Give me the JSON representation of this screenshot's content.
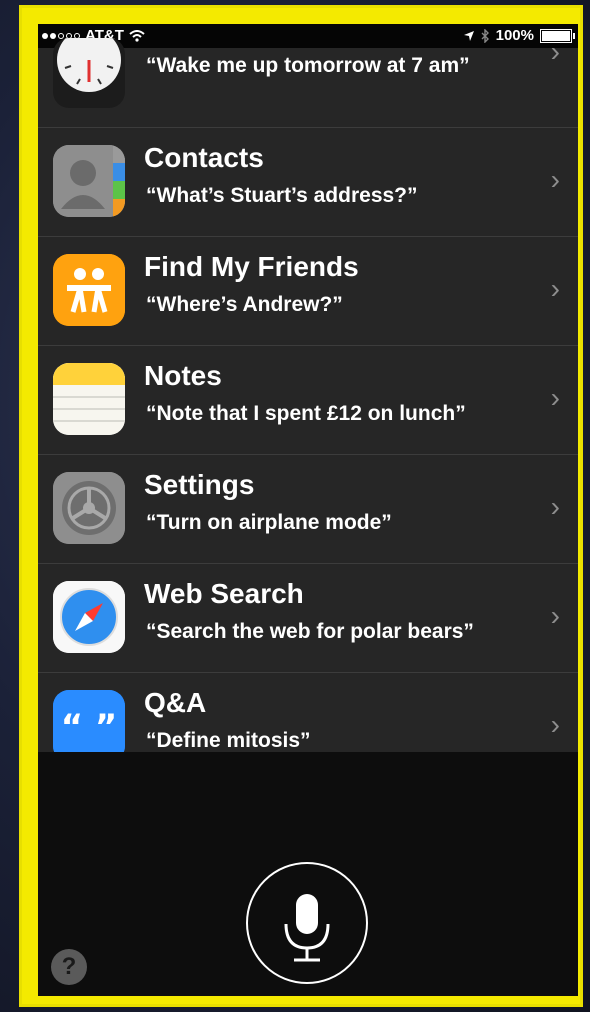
{
  "status_bar": {
    "carrier": "AT&T",
    "battery": "100%"
  },
  "items": [
    {
      "title": "",
      "subtitle": "“Wake me up tomorrow at 7 am”",
      "icon": "clock-icon"
    },
    {
      "title": "Contacts",
      "subtitle": "“What’s Stuart’s address?”",
      "icon": "contacts-icon"
    },
    {
      "title": "Find My Friends",
      "subtitle": "“Where’s Andrew?”",
      "icon": "find-my-friends-icon"
    },
    {
      "title": "Notes",
      "subtitle": "“Note that I spent £12 on lunch”",
      "icon": "notes-icon"
    },
    {
      "title": "Settings",
      "subtitle": "“Turn on airplane mode”",
      "icon": "settings-icon"
    },
    {
      "title": "Web Search",
      "subtitle": "“Search the web for polar bears”",
      "icon": "safari-icon"
    },
    {
      "title": "Q&A",
      "subtitle": "“Define mitosis”",
      "icon": "quotes-icon"
    }
  ],
  "chevron": "›",
  "help_label": "?",
  "colors": {
    "highlight_border": "#f4ea00",
    "list_bg": "#262626",
    "find_friends": "#ff9f0a",
    "qa_blue": "#1e88ff"
  }
}
